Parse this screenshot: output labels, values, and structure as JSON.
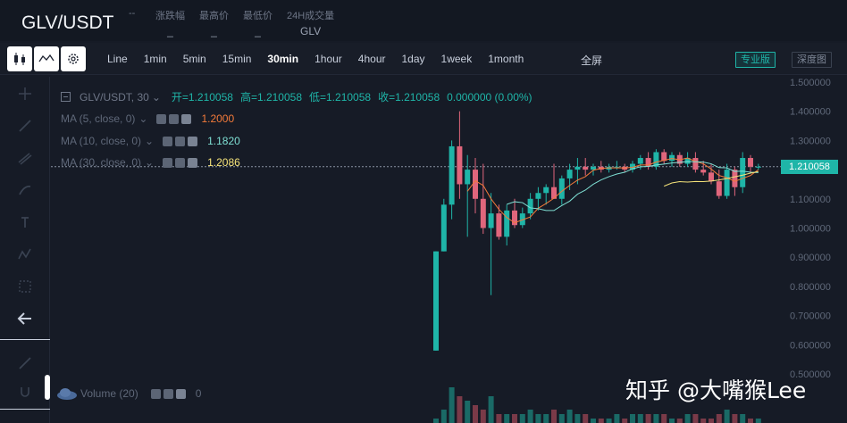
{
  "header": {
    "pair": "GLV/USDT",
    "change_value": "--",
    "stats": [
      {
        "label": "涨跌幅",
        "value": "_"
      },
      {
        "label": "最高价",
        "value": "_"
      },
      {
        "label": "最低价",
        "value": "_"
      },
      {
        "label": "24H成交量",
        "value": "GLV"
      }
    ]
  },
  "toolbar": {
    "intervals": [
      "Line",
      "1min",
      "5min",
      "15min",
      "30min",
      "1hour",
      "4hour",
      "1day",
      "1week",
      "1month"
    ],
    "active_interval": "30min",
    "fullscreen_label": "全屏",
    "pro_label": "专业版",
    "depth_label": "深度图"
  },
  "main_legend": {
    "symbol": "GLV/USDT, 30",
    "open": "开=1.210058",
    "high": "高=1.210058",
    "low": "低=1.210058",
    "close": "收=1.210058",
    "change": "0.000000 (0.00%)"
  },
  "indicators": [
    {
      "name": "MA (5, close, 0)",
      "value": "1.2000",
      "color": "#f27a3a"
    },
    {
      "name": "MA (10, close, 0)",
      "value": "1.1820",
      "color": "#7fe0d4"
    },
    {
      "name": "MA (30, close, 0)",
      "value": "1.2086",
      "color": "#f5e37a"
    }
  ],
  "volume_legend": {
    "name": "Volume (20)",
    "value": "0"
  },
  "price_axis": [
    "1.500000",
    "1.400000",
    "1.300000",
    "1.100000",
    "1.000000",
    "0.900000",
    "0.800000",
    "0.700000",
    "0.600000",
    "0.500000"
  ],
  "current_price": "1.210058",
  "watermark": "知乎 @大嘴猴Lee",
  "colors": {
    "up": "#1fb5a8",
    "down": "#e0667c",
    "accent": "#1fb5a8"
  },
  "chart_data": {
    "type": "candlestick",
    "interval": "30min",
    "candles": [
      {
        "o": 0.58,
        "h": 0.92,
        "l": 0.58,
        "c": 0.92
      },
      {
        "o": 0.92,
        "h": 1.1,
        "l": 0.92,
        "c": 1.08
      },
      {
        "o": 1.08,
        "h": 1.3,
        "l": 1.03,
        "c": 1.28
      },
      {
        "o": 1.28,
        "h": 1.4,
        "l": 1.1,
        "c": 1.15
      },
      {
        "o": 1.15,
        "h": 1.25,
        "l": 0.97,
        "c": 1.2
      },
      {
        "o": 1.2,
        "h": 1.24,
        "l": 1.05,
        "c": 1.1
      },
      {
        "o": 1.1,
        "h": 1.22,
        "l": 0.98,
        "c": 1.0
      },
      {
        "o": 1.0,
        "h": 1.12,
        "l": 0.77,
        "c": 1.05
      },
      {
        "o": 1.05,
        "h": 1.08,
        "l": 0.96,
        "c": 0.97
      },
      {
        "o": 0.97,
        "h": 1.08,
        "l": 0.94,
        "c": 1.06
      },
      {
        "o": 1.06,
        "h": 1.1,
        "l": 1.0,
        "c": 1.01
      },
      {
        "o": 1.01,
        "h": 1.07,
        "l": 1.0,
        "c": 1.05
      },
      {
        "o": 1.05,
        "h": 1.12,
        "l": 1.03,
        "c": 1.1
      },
      {
        "o": 1.1,
        "h": 1.14,
        "l": 1.06,
        "c": 1.12
      },
      {
        "o": 1.12,
        "h": 1.15,
        "l": 1.08,
        "c": 1.14
      },
      {
        "o": 1.14,
        "h": 1.22,
        "l": 1.1,
        "c": 1.1
      },
      {
        "o": 1.1,
        "h": 1.18,
        "l": 1.08,
        "c": 1.17
      },
      {
        "o": 1.17,
        "h": 1.22,
        "l": 1.13,
        "c": 1.2
      },
      {
        "o": 1.2,
        "h": 1.24,
        "l": 1.15,
        "c": 1.21
      },
      {
        "o": 1.21,
        "h": 1.24,
        "l": 1.18,
        "c": 1.2
      },
      {
        "o": 1.2,
        "h": 1.22,
        "l": 1.18,
        "c": 1.21
      },
      {
        "o": 1.21,
        "h": 1.23,
        "l": 1.19,
        "c": 1.2
      },
      {
        "o": 1.2,
        "h": 1.22,
        "l": 1.19,
        "c": 1.21
      },
      {
        "o": 1.21,
        "h": 1.23,
        "l": 1.2,
        "c": 1.21
      },
      {
        "o": 1.21,
        "h": 1.22,
        "l": 1.19,
        "c": 1.2
      },
      {
        "o": 1.2,
        "h": 1.23,
        "l": 1.19,
        "c": 1.22
      },
      {
        "o": 1.22,
        "h": 1.25,
        "l": 1.2,
        "c": 1.24
      },
      {
        "o": 1.24,
        "h": 1.26,
        "l": 1.2,
        "c": 1.21
      },
      {
        "o": 1.21,
        "h": 1.27,
        "l": 1.2,
        "c": 1.26
      },
      {
        "o": 1.26,
        "h": 1.27,
        "l": 1.22,
        "c": 1.23
      },
      {
        "o": 1.23,
        "h": 1.26,
        "l": 1.21,
        "c": 1.25
      },
      {
        "o": 1.25,
        "h": 1.26,
        "l": 1.21,
        "c": 1.22
      },
      {
        "o": 1.22,
        "h": 1.26,
        "l": 1.21,
        "c": 1.24
      },
      {
        "o": 1.24,
        "h": 1.26,
        "l": 1.19,
        "c": 1.2
      },
      {
        "o": 1.2,
        "h": 1.23,
        "l": 1.18,
        "c": 1.19
      },
      {
        "o": 1.19,
        "h": 1.22,
        "l": 1.15,
        "c": 1.16
      },
      {
        "o": 1.16,
        "h": 1.2,
        "l": 1.1,
        "c": 1.11
      },
      {
        "o": 1.11,
        "h": 1.22,
        "l": 1.1,
        "c": 1.2
      },
      {
        "o": 1.2,
        "h": 1.21,
        "l": 1.11,
        "c": 1.14
      },
      {
        "o": 1.14,
        "h": 1.26,
        "l": 1.12,
        "c": 1.24
      },
      {
        "o": 1.24,
        "h": 1.25,
        "l": 1.19,
        "c": 1.21
      },
      {
        "o": 1.21,
        "h": 1.22,
        "l": 1.2,
        "c": 1.21
      }
    ],
    "volumes": [
      1,
      3,
      8,
      6,
      5,
      4,
      3,
      6,
      2,
      2,
      2,
      2,
      3,
      2,
      2,
      3,
      2,
      3,
      2,
      2,
      1,
      1,
      1,
      2,
      1,
      2,
      2,
      2,
      2,
      2,
      1,
      1,
      2,
      2,
      1,
      1,
      2,
      3,
      2,
      2,
      1,
      1
    ],
    "ylim": [
      0.5,
      1.5
    ]
  }
}
